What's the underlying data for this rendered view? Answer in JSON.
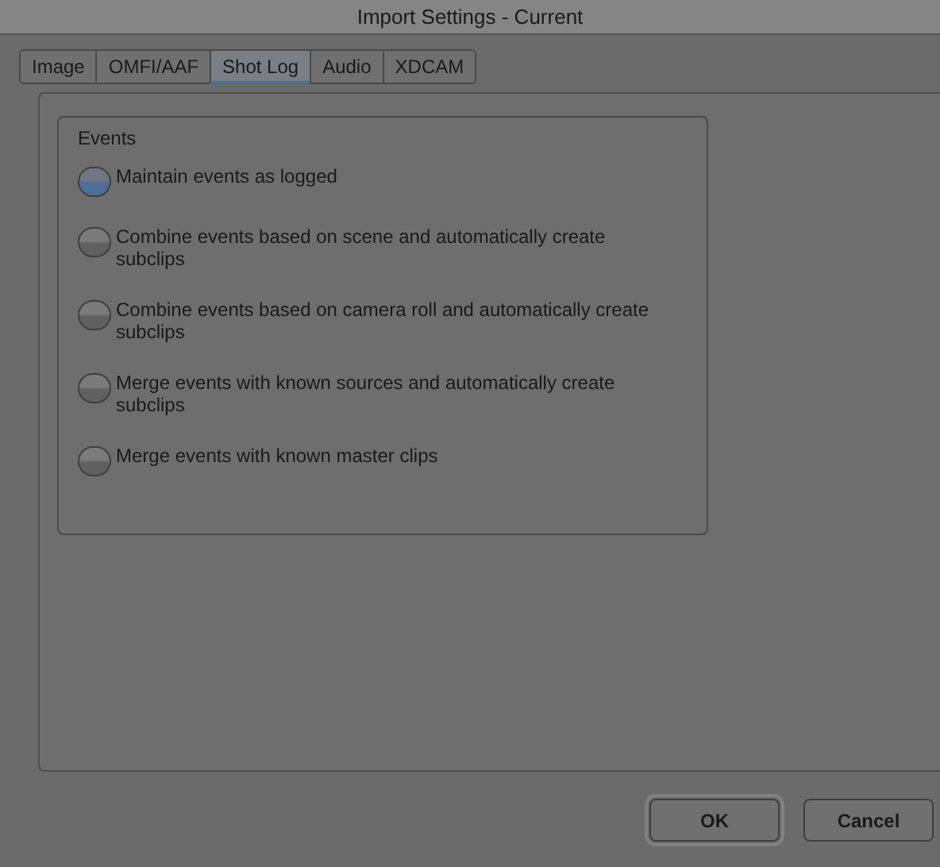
{
  "window": {
    "title": "Import Settings - Current"
  },
  "tabs": [
    {
      "label": "Image",
      "selected": false
    },
    {
      "label": "OMFI/AAF",
      "selected": false
    },
    {
      "label": "Shot Log",
      "selected": true
    },
    {
      "label": "Audio",
      "selected": false
    },
    {
      "label": "XDCAM",
      "selected": false
    }
  ],
  "events": {
    "title": "Events",
    "options": [
      {
        "label": "Maintain events as logged",
        "selected": true
      },
      {
        "label": "Combine events based on scene and automatically create subclips",
        "selected": false
      },
      {
        "label": "Combine events based on camera roll and automatically create subclips",
        "selected": false
      },
      {
        "label": "Merge events with known sources and automatically create subclips",
        "selected": false
      },
      {
        "label": "Merge events with known master clips",
        "selected": false
      }
    ]
  },
  "buttons": [
    {
      "label": "OK",
      "default": true
    },
    {
      "label": "Cancel",
      "default": false
    }
  ]
}
